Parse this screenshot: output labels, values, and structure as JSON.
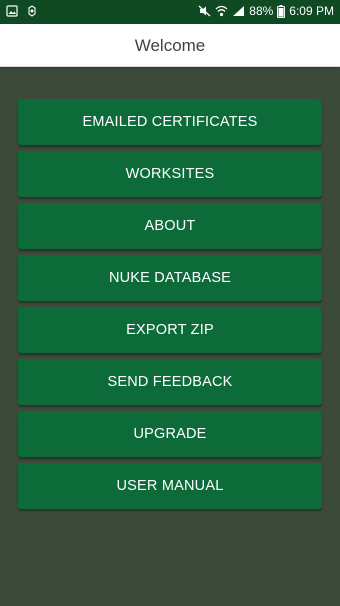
{
  "status_bar": {
    "battery": "88%",
    "time": "6:09 PM",
    "left_icons": [
      "image-notification-icon",
      "media-notification-icon"
    ],
    "right_icons": [
      "mute-icon",
      "wifi-icon",
      "signal-icon",
      "battery-icon"
    ]
  },
  "app_bar": {
    "title": "Welcome"
  },
  "menu": {
    "items": [
      {
        "label": "EMAILED CERTIFICATES"
      },
      {
        "label": "WORKSITES"
      },
      {
        "label": "ABOUT"
      },
      {
        "label": "NUKE DATABASE"
      },
      {
        "label": "EXPORT ZIP"
      },
      {
        "label": "SEND FEEDBACK"
      },
      {
        "label": "UPGRADE"
      },
      {
        "label": "USER MANUAL"
      }
    ]
  },
  "colors": {
    "background": "#3c4a3b",
    "status_bar": "#0f4a23",
    "button": "#0d6b3a",
    "button_text": "#ffffff",
    "app_bar": "#ffffff"
  }
}
